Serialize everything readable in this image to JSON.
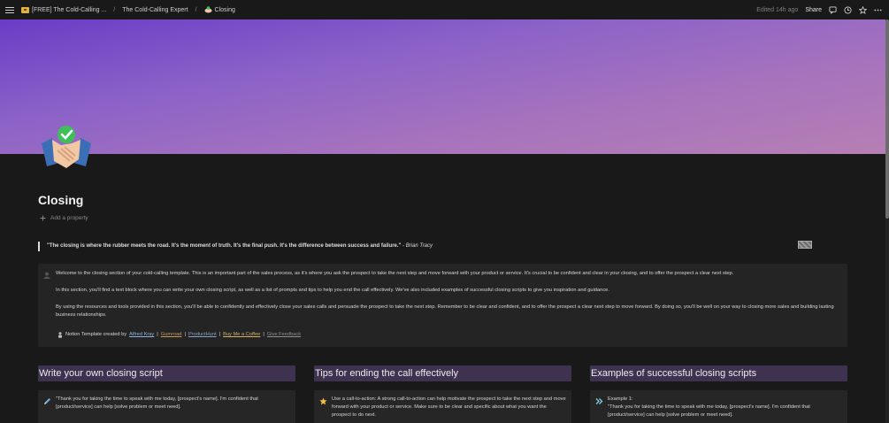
{
  "topbar": {
    "breadcrumbs": [
      "[FREE] The Cold-Calling ...",
      "The Cold-Calling Expert",
      "Closing"
    ],
    "edited": "Edited 14h ago",
    "share": "Share"
  },
  "page": {
    "title": "Closing",
    "add_property": "Add a property"
  },
  "quote": {
    "text": "\"The closing is where the rubber meets the road. It's the moment of truth. It's the final push. It's the difference between success and failure.\"",
    "separator": " - ",
    "author": "Brian Tracy"
  },
  "callout": {
    "p1": "Welcome to the closing section of your cold-calling template. This is an important part of the sales process, as it's where you ask the prospect to take the next step and move forward with your product or service. It's crucial to be confident and clear in your closing, and to offer the prospect a clear next step.",
    "p2": "In this section, you'll find a text block where you can write your own closing script, as well as a list of prompts and tips to help you end the call effectively. We've also included examples of successful closing scripts to give you inspiration and guidance.",
    "p3": "By using the resources and tools provided in this section, you'll be able to confidently and effectively close your sales calls and persuade the prospect to take the next step. Remember to be clear and confident, and to offer the prospect a clear next step to move forward. By doing so, you'll be well on your way to closing more sales and building lasting business relationships.",
    "credit_prefix": "Notion Template created by",
    "links": [
      "Alfred Kray",
      "Gumroad",
      "ProductHunt",
      "Buy Me a Coffee",
      "Give Feedback"
    ],
    "sep": "|"
  },
  "columns": [
    {
      "heading": "Write your own closing script",
      "icon": "pencil-icon",
      "text": "\"Thank you for taking the time to speak with me today, [prospect's name]. I'm confident that [product/service] can help [solve problem or meet need]."
    },
    {
      "heading": "Tips for ending the call effectively",
      "icon": "star-icon",
      "text": "Use a call-to-action: A strong call-to-action can help motivate the prospect to take the next step and move forward with your product or service. Make sure to be clear and specific about what you want the prospect to do next."
    },
    {
      "heading": "Examples of successful closing scripts",
      "icon": "double-chevron-icon",
      "label": "Example 1:",
      "text": "\"Thank you for taking the time to speak with me today, [prospect's name]. I'm confident that [product/service] can help [solve problem or meet need]."
    }
  ]
}
